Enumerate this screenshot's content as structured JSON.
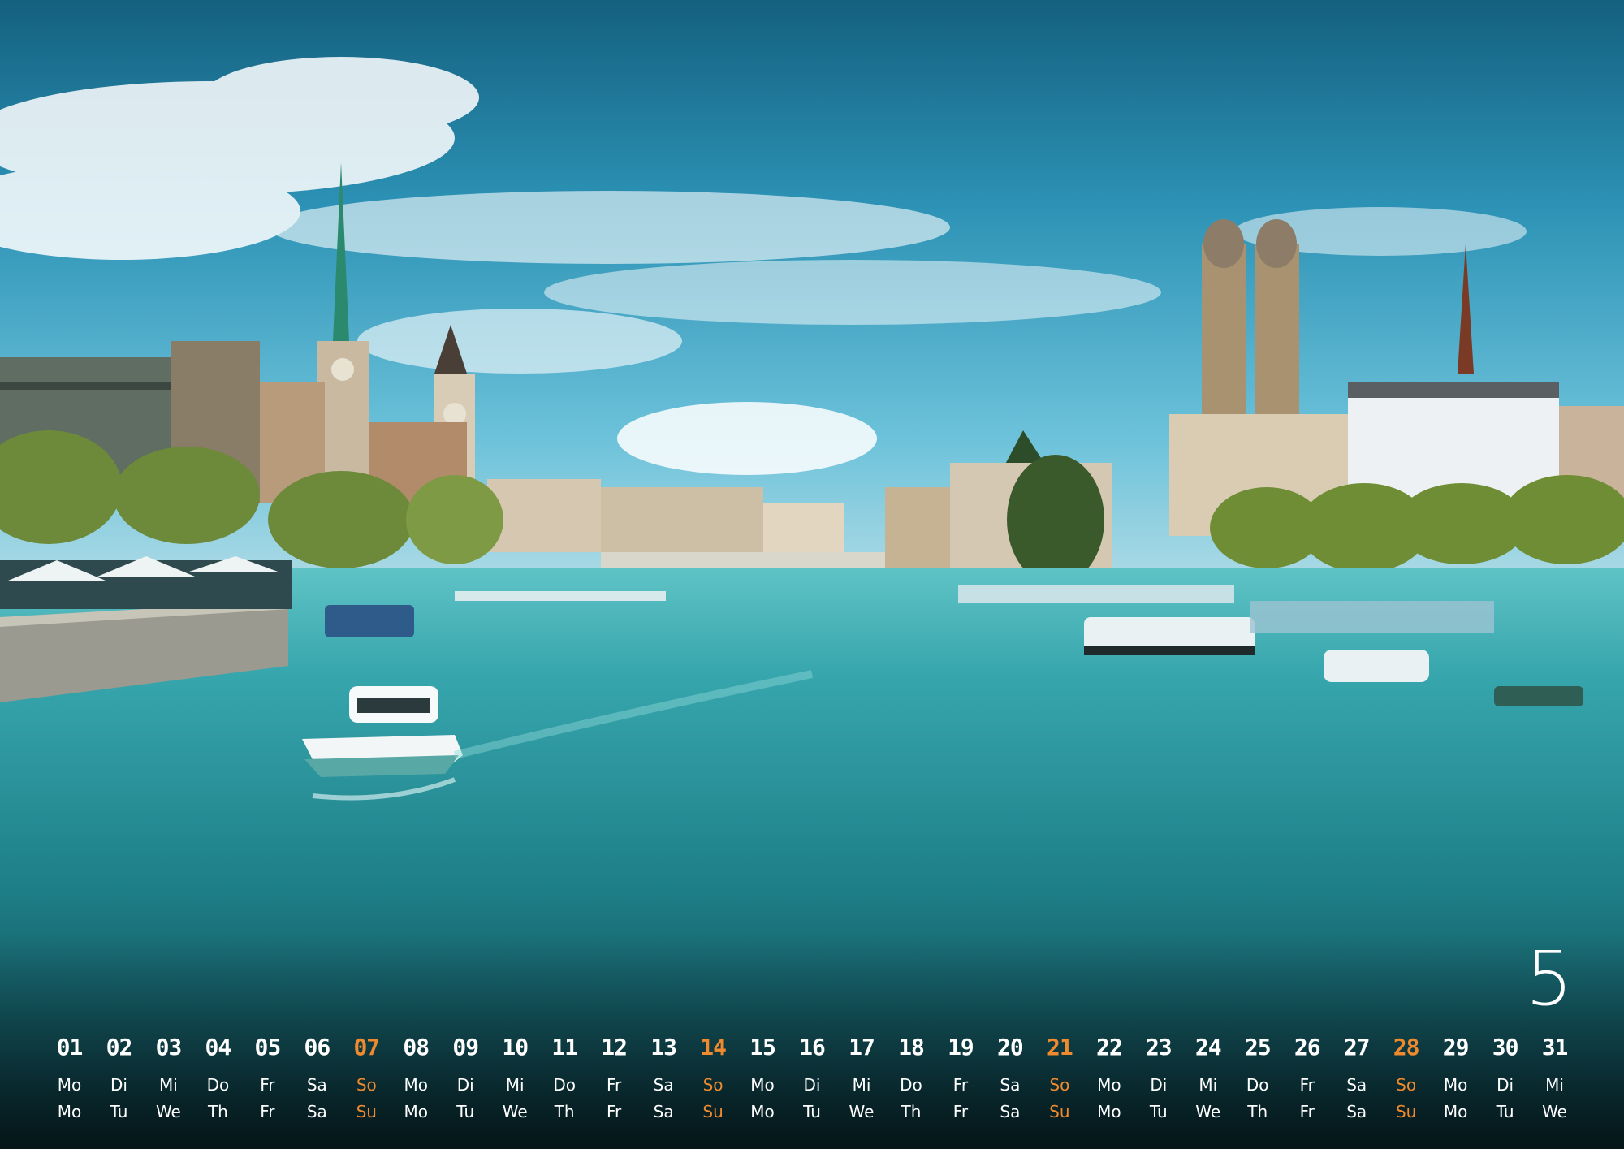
{
  "month": "5",
  "calendar": {
    "days": [
      {
        "num": "01",
        "de": "Mo",
        "en": "Mo",
        "sunday": false
      },
      {
        "num": "02",
        "de": "Di",
        "en": "Tu",
        "sunday": false
      },
      {
        "num": "03",
        "de": "Mi",
        "en": "We",
        "sunday": false
      },
      {
        "num": "04",
        "de": "Do",
        "en": "Th",
        "sunday": false
      },
      {
        "num": "05",
        "de": "Fr",
        "en": "Fr",
        "sunday": false
      },
      {
        "num": "06",
        "de": "Sa",
        "en": "Sa",
        "sunday": false
      },
      {
        "num": "07",
        "de": "So",
        "en": "Su",
        "sunday": true
      },
      {
        "num": "08",
        "de": "Mo",
        "en": "Mo",
        "sunday": false
      },
      {
        "num": "09",
        "de": "Di",
        "en": "Tu",
        "sunday": false
      },
      {
        "num": "10",
        "de": "Mi",
        "en": "We",
        "sunday": false
      },
      {
        "num": "11",
        "de": "Do",
        "en": "Th",
        "sunday": false
      },
      {
        "num": "12",
        "de": "Fr",
        "en": "Fr",
        "sunday": false
      },
      {
        "num": "13",
        "de": "Sa",
        "en": "Sa",
        "sunday": false
      },
      {
        "num": "14",
        "de": "So",
        "en": "Su",
        "sunday": true
      },
      {
        "num": "15",
        "de": "Mo",
        "en": "Mo",
        "sunday": false
      },
      {
        "num": "16",
        "de": "Di",
        "en": "Tu",
        "sunday": false
      },
      {
        "num": "17",
        "de": "Mi",
        "en": "We",
        "sunday": false
      },
      {
        "num": "18",
        "de": "Do",
        "en": "Th",
        "sunday": false
      },
      {
        "num": "19",
        "de": "Fr",
        "en": "Fr",
        "sunday": false
      },
      {
        "num": "20",
        "de": "Sa",
        "en": "Sa",
        "sunday": false
      },
      {
        "num": "21",
        "de": "So",
        "en": "Su",
        "sunday": true
      },
      {
        "num": "22",
        "de": "Mo",
        "en": "Mo",
        "sunday": false
      },
      {
        "num": "23",
        "de": "Di",
        "en": "Tu",
        "sunday": false
      },
      {
        "num": "24",
        "de": "Mi",
        "en": "We",
        "sunday": false
      },
      {
        "num": "25",
        "de": "Do",
        "en": "Th",
        "sunday": false
      },
      {
        "num": "26",
        "de": "Fr",
        "en": "Fr",
        "sunday": false
      },
      {
        "num": "27",
        "de": "Sa",
        "en": "Sa",
        "sunday": false
      },
      {
        "num": "28",
        "de": "So",
        "en": "Su",
        "sunday": true
      },
      {
        "num": "29",
        "de": "Mo",
        "en": "Mo",
        "sunday": false
      },
      {
        "num": "30",
        "de": "Di",
        "en": "Tu",
        "sunday": false
      },
      {
        "num": "31",
        "de": "Mi",
        "en": "We",
        "sunday": false
      }
    ]
  },
  "colors": {
    "sunday": "#f08a2e",
    "text": "#ffffff",
    "sky_top": "#1b6f97",
    "water": "#2b9aa4"
  }
}
